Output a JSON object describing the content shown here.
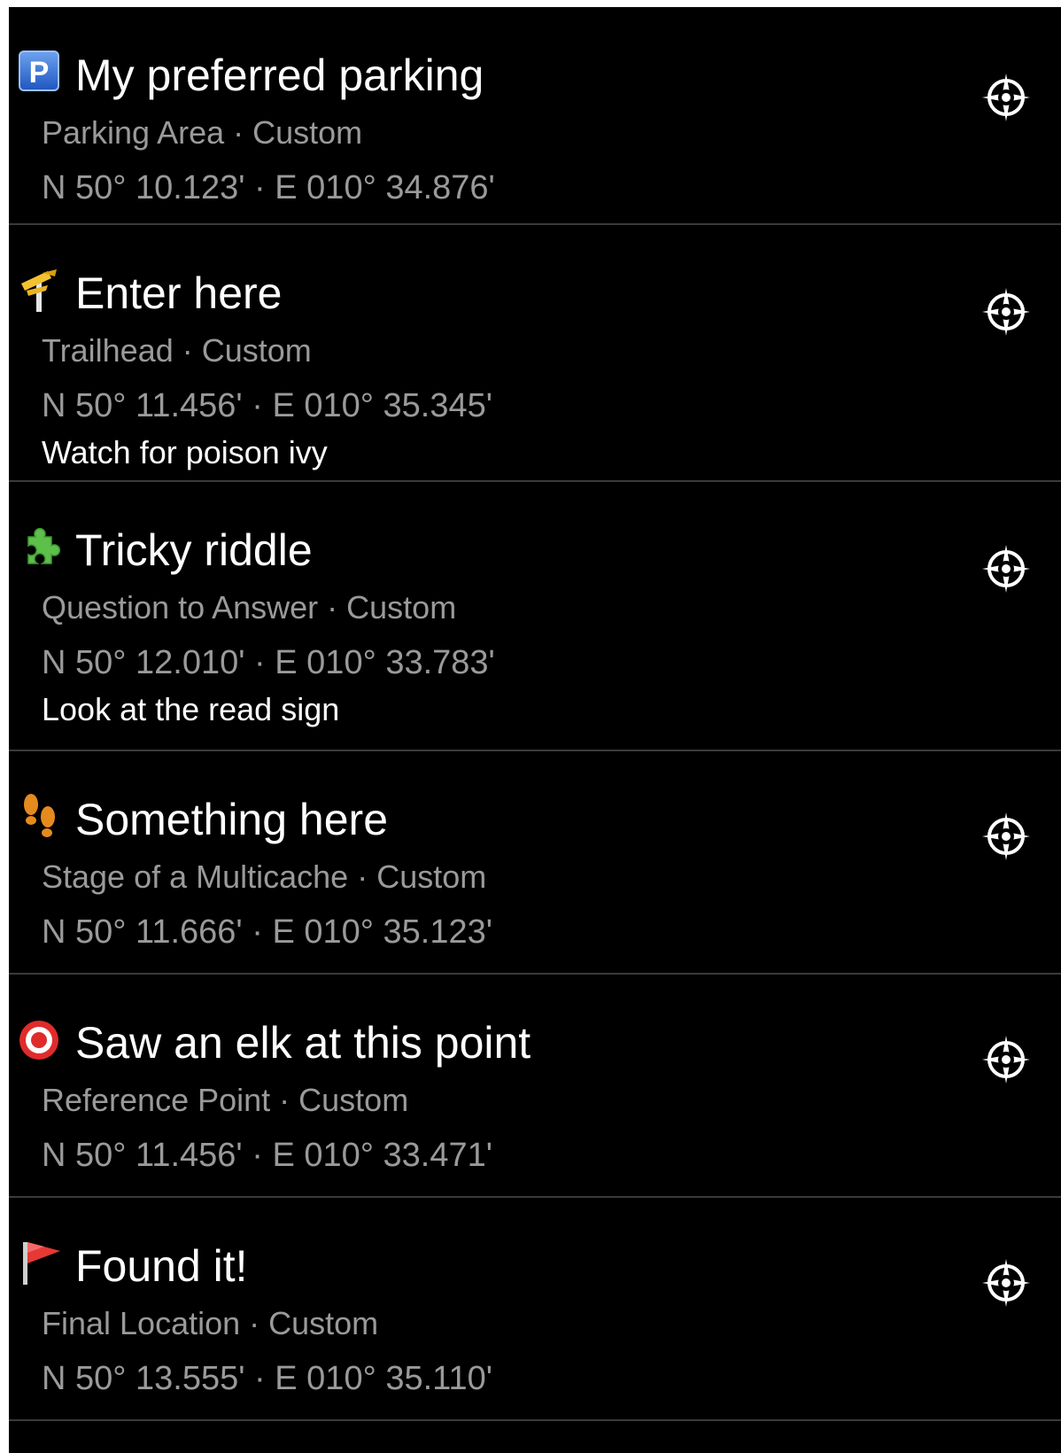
{
  "waypoints": [
    {
      "name": "My preferred parking",
      "type_line": "Parking Area · Custom",
      "coords": "N 50° 10.123' · E 010° 34.876'",
      "note": "",
      "icon": "parking-icon"
    },
    {
      "name": "Enter here",
      "type_line": "Trailhead · Custom",
      "coords": "N 50° 11.456' · E 010° 35.345'",
      "note": "Watch for poison ivy",
      "icon": "trailhead-signpost-icon"
    },
    {
      "name": "Tricky riddle",
      "type_line": "Question to Answer · Custom",
      "coords": "N 50° 12.010' · E 010° 33.783'",
      "note": "Look at the read sign",
      "icon": "puzzle-piece-icon"
    },
    {
      "name": "Something here",
      "type_line": "Stage of a Multicache · Custom",
      "coords": "N 50° 11.666' · E 010° 35.123'",
      "note": "",
      "icon": "footprints-icon"
    },
    {
      "name": "Saw an elk at this point",
      "type_line": "Reference Point · Custom",
      "coords": "N 50° 11.456' · E 010° 33.471'",
      "note": "",
      "icon": "reference-point-icon"
    },
    {
      "name": "Found it!",
      "type_line": "Final Location · Custom",
      "coords": "N 50° 13.555' · E 010° 35.110'",
      "note": "",
      "icon": "red-flag-icon"
    }
  ],
  "colors": {
    "background": "#000000",
    "title": "#ffffff",
    "secondary": "#9a9a9a",
    "divider": "#3a3a3a",
    "parking_blue": "#2f6fd8",
    "trailhead_yellow": "#f3c230",
    "puzzle_green": "#5cc04a",
    "footprints_orange": "#e58a1f",
    "reference_red": "#e02b2b",
    "flag_red": "#e53935"
  },
  "nav_icon": "compass-navigate-icon"
}
